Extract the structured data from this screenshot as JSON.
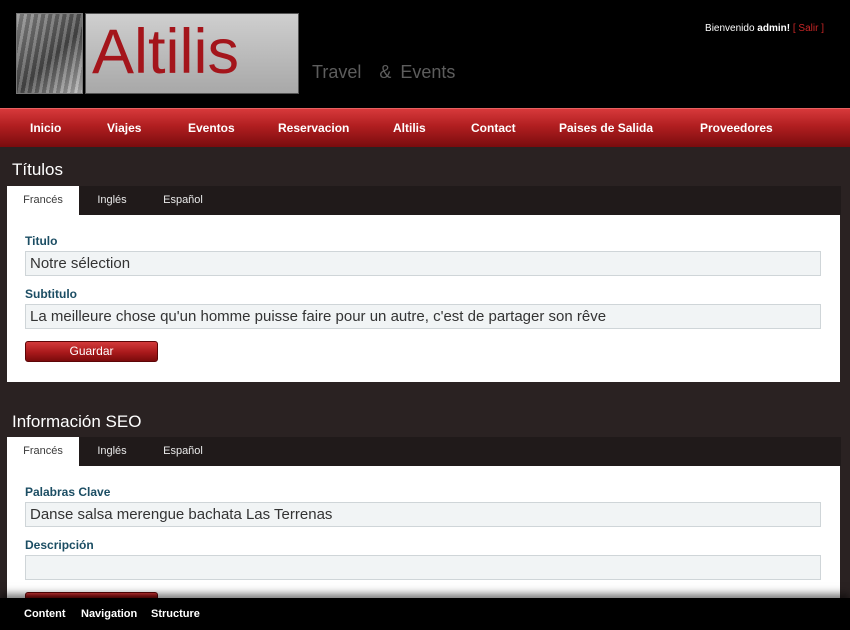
{
  "header": {
    "brand": "Altilis",
    "tagline": "Travel  & Events",
    "welcome_prefix": "Bienvenido",
    "username": "admin!",
    "bracket_open": "[",
    "logout_label": "Salir",
    "bracket_close": "]"
  },
  "nav": {
    "items": [
      "Inicio",
      "Viajes",
      "Eventos",
      "Reservacion",
      "Altilis",
      "Contact",
      "Paises de Salida",
      "Proveedores"
    ]
  },
  "titles_section": {
    "heading": "Títulos",
    "tabs": [
      "Francés",
      "Inglés",
      "Español"
    ],
    "active_tab": "Francés",
    "fields": [
      {
        "label": "Titulo",
        "value": "Notre sélection"
      },
      {
        "label": "Subtitulo",
        "value": "La meilleure chose qu'un homme puisse faire pour un autre, c'est de partager son rêve"
      }
    ],
    "save_label": "Guardar"
  },
  "seo_section": {
    "heading": "Información SEO",
    "tabs": [
      "Francés",
      "Inglés",
      "Español"
    ],
    "active_tab": "Francés",
    "fields": [
      {
        "label": "Palabras Clave",
        "value": "Danse salsa merengue bachata Las Terrenas"
      },
      {
        "label": "Descripción",
        "value": ""
      }
    ]
  },
  "bottom_bar": {
    "items": [
      "Content",
      "Navigation",
      "Structure"
    ]
  },
  "colors": {
    "accent_red": "#b01e20",
    "label_blue": "#1b4d63",
    "background": "#2a2222"
  }
}
